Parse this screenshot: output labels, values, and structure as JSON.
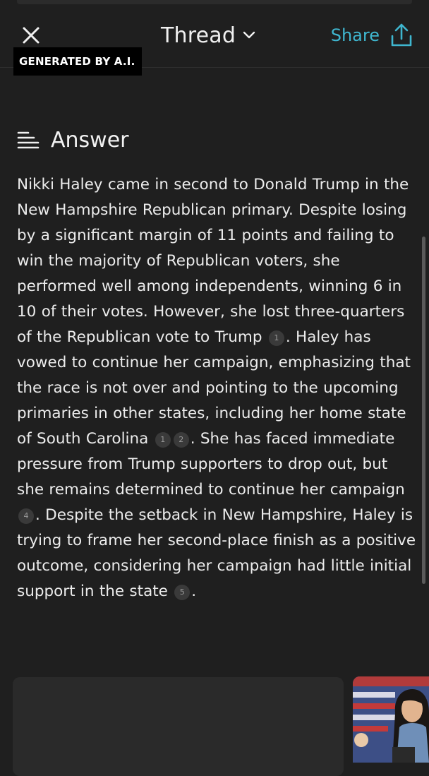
{
  "header": {
    "title": "Thread",
    "share_label": "Share",
    "icons": {
      "close": "close-icon",
      "chevron": "chevron-down-icon",
      "share": "share-upload-icon"
    }
  },
  "badge": {
    "text": "GENERATED BY A.I."
  },
  "answer": {
    "heading": "Answer",
    "heading_icon": "answer-lines-icon",
    "segments": {
      "s1": "Nikki Haley came in second to Donald Trump in the New Hampshire Republican primary. Despite losing by a significant margin of 11 points and failing to win the majority of Republican voters, she performed well among independents, winning 6 in 10 of their votes. However, she lost three-quarters of the Republican vote to Trump",
      "s2": ". Haley has vowed to continue her campaign, emphasizing that the race is not over and pointing to the upcoming primaries in other states, including her home state of South Carolina",
      "s3": ". She has faced immediate pressure from Trump supporters to drop out, but she remains determined to continue her campaign",
      "s4": ". Despite the setback in New Hampshire, Haley is trying to frame her second-place finish as a positive outcome, considering her campaign had little initial support in the state",
      "s5": "."
    },
    "citations": {
      "c1": "1",
      "c1b": "1",
      "c2": "2",
      "c4": "4",
      "c5": "5"
    }
  },
  "colors": {
    "background": "#1f1f1f",
    "accent": "#3fb6cf",
    "text": "#ececec"
  },
  "thumbnail": {
    "subject": "speaker-at-podium-photo"
  }
}
